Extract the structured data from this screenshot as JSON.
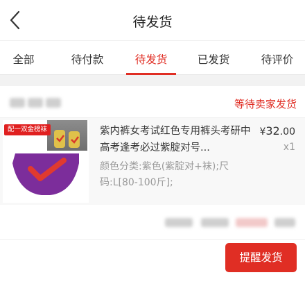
{
  "header": {
    "title": "待发货",
    "back_icon": "chevron-left-icon"
  },
  "tabs": [
    {
      "label": "全部"
    },
    {
      "label": "待付款"
    },
    {
      "label": "待发货",
      "active": true
    },
    {
      "label": "已发货"
    },
    {
      "label": "待评价"
    }
  ],
  "order": {
    "status": "等待卖家发货",
    "product": {
      "promo_tag": "配一双金榜袜",
      "title": "紫内裤女考试红色专用裤头考研中高考逢考必过紫腚对号...",
      "spec": "颜色分类:紫色(紫腚对+袜);尺码:L[80-100斤];",
      "price_currency": "¥",
      "price_int": "32",
      "price_dec": ".00",
      "quantity": "x1"
    },
    "remind_button": "提醒发货"
  },
  "colors": {
    "accent": "#e02e24",
    "product_bg": "#f8f8f8",
    "underwear": "#7c2d9b"
  }
}
